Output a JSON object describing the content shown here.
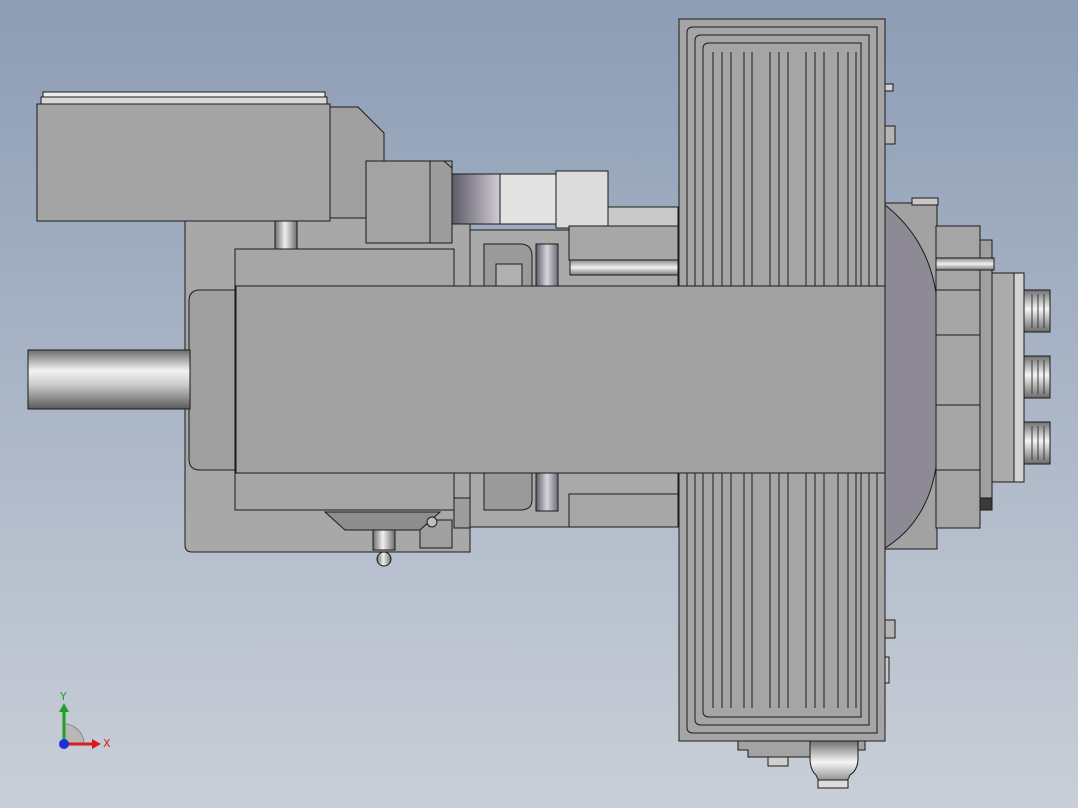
{
  "viewport": {
    "background_top": "#8d9db5",
    "background_bottom": "#c9cfd8"
  },
  "colors": {
    "body_fill": "#a6a6a6",
    "body_dark": "#8f8f8f",
    "body_light": "#b8b8b8",
    "edge": "#1a1a1a",
    "axis_x": "#d81c1c",
    "axis_y": "#1fa02a",
    "axis_z": "#1c2fd8"
  },
  "triad": {
    "x_label": "X",
    "y_label": "Y"
  }
}
